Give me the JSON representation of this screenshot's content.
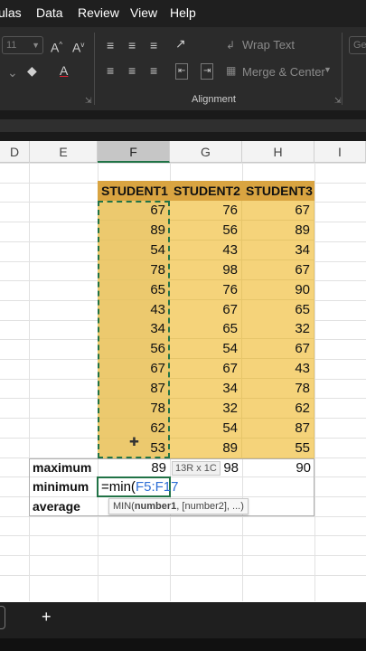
{
  "menu": [
    "ulas",
    "Data",
    "Review",
    "View",
    "Help"
  ],
  "ribbon": {
    "font_size": "11",
    "wrap_text": "Wrap Text",
    "merge_center": "Merge & Center",
    "group_alignment": "Alignment",
    "number_format": "Gen"
  },
  "columns": [
    "D",
    "E",
    "F",
    "G",
    "H",
    "I"
  ],
  "headers": [
    "STUDENT1",
    "STUDENT2",
    "STUDENT3"
  ],
  "rows": [
    [
      "67",
      "76",
      "67"
    ],
    [
      "89",
      "56",
      "89"
    ],
    [
      "54",
      "43",
      "34"
    ],
    [
      "78",
      "98",
      "67"
    ],
    [
      "65",
      "76",
      "90"
    ],
    [
      "43",
      "67",
      "65"
    ],
    [
      "34",
      "65",
      "32"
    ],
    [
      "56",
      "54",
      "67"
    ],
    [
      "67",
      "67",
      "43"
    ],
    [
      "87",
      "34",
      "78"
    ],
    [
      "78",
      "32",
      "62"
    ],
    [
      "62",
      "54",
      "87"
    ],
    [
      "53",
      "89",
      "55"
    ]
  ],
  "summary": {
    "maximum_label": "maximum",
    "minimum_label": "minimum",
    "average_label": "average",
    "max_values": [
      "89",
      "98",
      "90"
    ],
    "formula_prefix": "=min(",
    "formula_ref": "F5:F17",
    "selection_tip": "13R x 1C",
    "tooltip_fn": "MIN(",
    "tooltip_arg": "number1",
    "tooltip_rest": ", [number2], ...)"
  },
  "sheet_tab_add": "+",
  "colors": {
    "header_fill": "#d9a441",
    "data_fill": "#f5d37a",
    "accent": "#217346",
    "ref_blue": "#2f6fd6"
  }
}
